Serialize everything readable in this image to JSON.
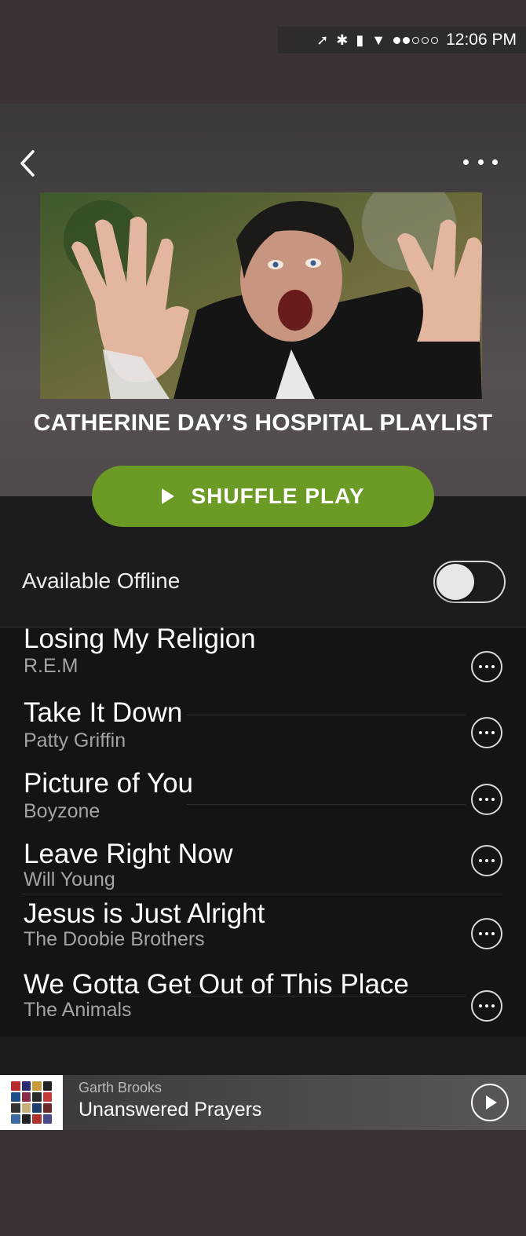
{
  "status_bar": {
    "time": "12:06 PM",
    "icons": [
      "location-arrow-icon",
      "bluetooth-icon",
      "battery-icon",
      "wifi-icon"
    ],
    "signal_bars_filled": 2,
    "signal_bars_total": 5
  },
  "header": {
    "back_icon": "chevron-left-icon",
    "more_icon": "more-horizontal-icon",
    "playlist_title": "CATHERINE DAY’S HOSPITAL PLAYLIST",
    "shuffle_label": "SHUFFLE PLAY",
    "shuffle_color": "#6b9a25"
  },
  "offline": {
    "label": "Available Offline",
    "enabled": false
  },
  "tracks": [
    {
      "title": "Losing My Religion",
      "artist": "R.E.M"
    },
    {
      "title": "Take It Down",
      "artist": "Patty Griffin"
    },
    {
      "title": "Picture of You",
      "artist": "Boyzone"
    },
    {
      "title": "Leave Right Now",
      "artist": "Will Young"
    },
    {
      "title": "Jesus is Just Alright",
      "artist": "The Doobie Brothers"
    },
    {
      "title": "We Gotta Get Out of This Place",
      "artist": "The Animals"
    }
  ],
  "now_playing": {
    "artist": "Garth Brooks",
    "title": "Unanswered Prayers",
    "play_icon": "play-circle-icon"
  }
}
